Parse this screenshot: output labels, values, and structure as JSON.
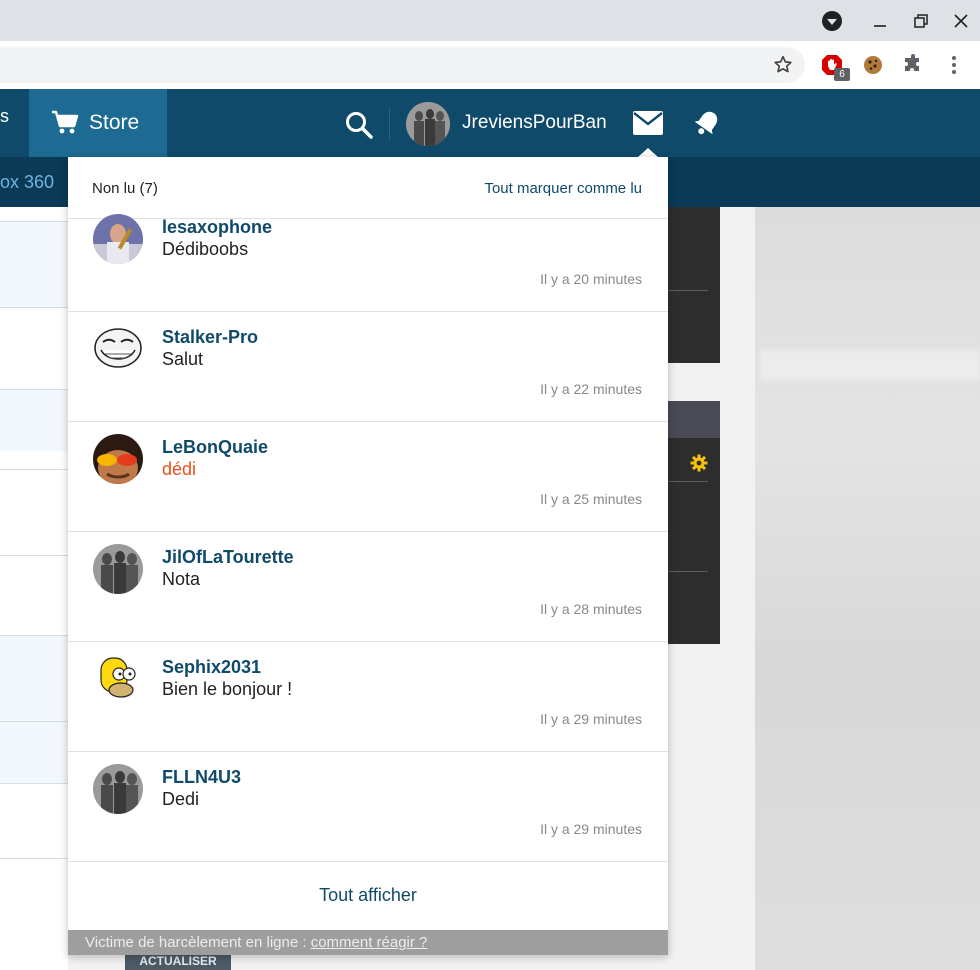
{
  "browser": {
    "extension_badge": "6"
  },
  "header": {
    "nav_partial": "s",
    "store_label": "Store",
    "username": "JreviensPourBan"
  },
  "subnav": {
    "partial_text": "ox 360"
  },
  "page": {
    "refresh_label": "ACTUALISER"
  },
  "dropdown": {
    "unread_label": "Non lu (7)",
    "mark_all_label": "Tout marquer comme lu",
    "messages": [
      {
        "name": "lesaxophone",
        "text": "Dédiboobs",
        "time": "Il y a 20 minutes"
      },
      {
        "name": "Stalker-Pro",
        "text": "Salut",
        "time": "Il y a 22 minutes"
      },
      {
        "name": "LeBonQuaie",
        "text": "dédi",
        "time": "Il y a 25 minutes"
      },
      {
        "name": "JilOfLaTourette",
        "text": "Nota",
        "time": "Il y a 28 minutes"
      },
      {
        "name": "Sephix2031",
        "text": "Bien le bonjour !",
        "time": "Il y a 29 minutes"
      },
      {
        "name": "FLLN4U3",
        "text": "Dedi",
        "time": "Il y a 29 minutes"
      }
    ],
    "show_all_label": "Tout afficher",
    "footer_text": "Victime de harcèlement en ligne : ",
    "footer_link": "comment réagir ?"
  },
  "colors": {
    "header_bg": "#0f4a6b",
    "store_tab_bg": "#1d6a93",
    "link": "#0f4a6b",
    "highlight_text": "#e8501a"
  }
}
